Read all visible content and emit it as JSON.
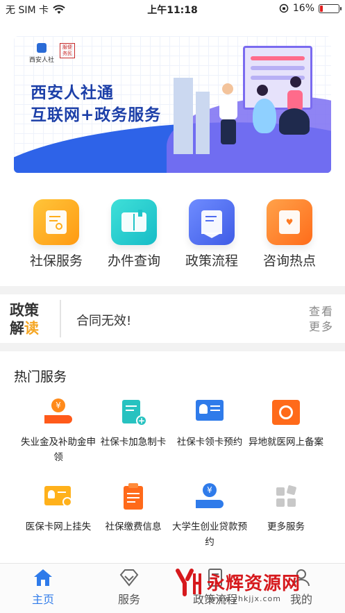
{
  "status_bar": {
    "carrier": "无 SIM 卡",
    "time": "上午11:18",
    "battery_percent": "16%",
    "battery_level": 0.16
  },
  "banner": {
    "org_name": "西安人社",
    "seal_text": "服便务民",
    "line1": "西安人社通",
    "line2": "互联网+政务服务"
  },
  "quick_entries": [
    {
      "label": "社保服务",
      "icon": "document-search-icon",
      "color": "#ffb11b"
    },
    {
      "label": "办件查询",
      "icon": "open-book-icon",
      "color": "#29cfd0"
    },
    {
      "label": "政策流程",
      "icon": "bookmark-doc-icon",
      "color": "#4f6cf0"
    },
    {
      "label": "咨询热点",
      "icon": "heart-card-icon",
      "color": "#ff8a2a"
    }
  ],
  "policy": {
    "badge_line1": "政策",
    "badge_line2_a": "解",
    "badge_line2_b": "读",
    "headline": "合同无效!",
    "more_line1": "查看",
    "more_line2": "更多"
  },
  "hot_services": {
    "title": "热门服务",
    "items": [
      {
        "label": "失业金及补助金申领",
        "icon": "money-hand-icon"
      },
      {
        "label": "社保卡加急制卡",
        "icon": "card-plus-icon"
      },
      {
        "label": "社保卡领卡预约",
        "icon": "id-card-icon"
      },
      {
        "label": "异地就医网上备案",
        "icon": "medical-cross-icon"
      },
      {
        "label": "医保卡网上挂失",
        "icon": "card-check-icon"
      },
      {
        "label": "社保缴费信息",
        "icon": "clipboard-icon"
      },
      {
        "label": "大学生创业贷款预约",
        "icon": "loan-hand-icon"
      },
      {
        "label": "更多服务",
        "icon": "grid-more-icon"
      }
    ]
  },
  "tabbar": {
    "items": [
      {
        "label": "主页",
        "icon": "home-icon",
        "active": true
      },
      {
        "label": "服务",
        "icon": "diamond-icon",
        "active": false
      },
      {
        "label": "政策流程",
        "icon": "doc-icon",
        "active": false
      },
      {
        "label": "我的",
        "icon": "user-icon",
        "active": false
      }
    ]
  },
  "watermark": {
    "name": "永辉资源网",
    "url": "www.yhkjjx.com"
  },
  "colors": {
    "accent": "#2f7bea",
    "hot_orange": "#ff6a1a",
    "hot_teal": "#20c0bd",
    "hot_blue": "#2f7bea"
  }
}
